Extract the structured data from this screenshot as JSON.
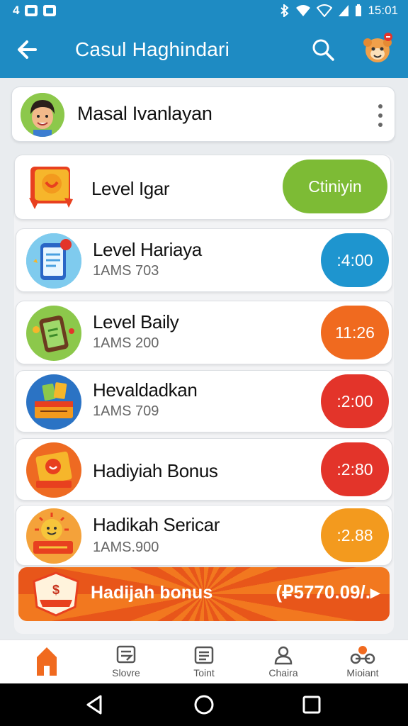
{
  "status_bar": {
    "left_text": "4",
    "time": "15:01"
  },
  "app_bar": {
    "title": "Casul Haghindari"
  },
  "profile": {
    "name": "Masal Ivanlayan"
  },
  "rows": [
    {
      "title": "Level Igar",
      "subtitle": "",
      "pill": "Ctiniyin",
      "pill_color": "#7dbb35"
    },
    {
      "title": "Level Hariaya",
      "subtitle": "1AMS 703",
      "pill": ":4:00",
      "pill_color": "#1e95cf"
    },
    {
      "title": "Level Baily",
      "subtitle": "1AMS 200",
      "pill": "11:26",
      "pill_color": "#f06a1f"
    },
    {
      "title": "Hevaldadkan",
      "subtitle": "1AMS 709",
      "pill": ":2:00",
      "pill_color": "#e3342a"
    },
    {
      "title": "Hadiyiah Bonus",
      "subtitle": "",
      "pill": ":2:80",
      "pill_color": "#e3342a"
    },
    {
      "title": "Hadikah Sericar",
      "subtitle": "1AMS.900",
      "pill": ":2.88",
      "pill_color": "#f39a1e"
    }
  ],
  "bonus_banner": {
    "label": "Hadijah bonus",
    "value": "(₽5770.09/.▸"
  },
  "bottom_nav": [
    {
      "label": ""
    },
    {
      "label": "Slovre"
    },
    {
      "label": "Toint"
    },
    {
      "label": "Chaira"
    },
    {
      "label": "Mioiant"
    }
  ],
  "colors": {
    "primary": "#1e8bc3",
    "accent_orange": "#f06a1f",
    "nav_active": "#f06a1f"
  }
}
